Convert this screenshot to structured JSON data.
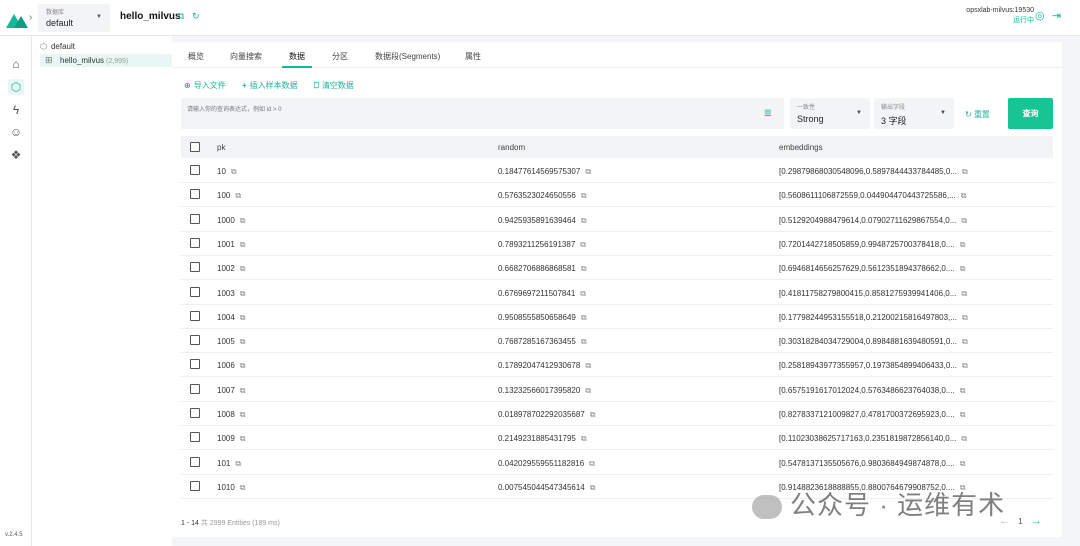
{
  "topbar": {
    "db_label": "数据库",
    "db_value": "default",
    "collection_title": "hello_milvus",
    "connection_host": "opsxlab-milvus:19530",
    "connection_status": "运行中"
  },
  "sidebar": {
    "icons": [
      "home-icon",
      "collection-icon",
      "lightning-icon",
      "user-icon",
      "settings-icon"
    ],
    "version": "v.2.4.5"
  },
  "tree": {
    "database": "default",
    "collection": "hello_milvus",
    "collection_count": "(2,999)"
  },
  "tabs": [
    "概览",
    "向量搜索",
    "数据",
    "分区",
    "数据段(Segments)",
    "属性"
  ],
  "actions": {
    "import_file": "导入文件",
    "insert_sample": "插入样本数据",
    "empty_data": "清空数据"
  },
  "filter": {
    "placeholder": "请输入你的查询表达式，例如 id > 0"
  },
  "consistency": {
    "label": "一致性",
    "value": "Strong"
  },
  "output_fields": {
    "label": "输出字段",
    "value": "3 字段"
  },
  "reset_label": "重置",
  "query_label": "查询",
  "table": {
    "columns": [
      "pk",
      "random",
      "embeddings"
    ],
    "rows": [
      {
        "pk": "10",
        "random": "0.18477614569575307",
        "emb": "[0.29879868030548096,0.5897844433784485,0..."
      },
      {
        "pk": "100",
        "random": "0.5763523024650556",
        "emb": "[0.5608611106872559,0.044904470443725586,..."
      },
      {
        "pk": "1000",
        "random": "0.9425935891639464",
        "emb": "[0.5129204988479614,0.07902711629867554,0..."
      },
      {
        "pk": "1001",
        "random": "0.7893211256191387",
        "emb": "[0.7201442718505859,0.9948725700378418,0...."
      },
      {
        "pk": "1002",
        "random": "0.6682706886868581",
        "emb": "[0.6946814656257629,0.5612351894378662,0...."
      },
      {
        "pk": "1003",
        "random": "0.6769697211507841",
        "emb": "[0.41811758279800415,0.8581275939941406,0..."
      },
      {
        "pk": "1004",
        "random": "0.9508555850658649",
        "emb": "[0.17798244953155518,0.21200215816497803,..."
      },
      {
        "pk": "1005",
        "random": "0.7687285167363455",
        "emb": "[0.30318284034729004,0.8984881639480591,0..."
      },
      {
        "pk": "1006",
        "random": "0.17892047412930678",
        "emb": "[0.25818943977355957,0.1973854899406433,0..."
      },
      {
        "pk": "1007",
        "random": "0.13232566017395820",
        "emb": "[0.6575191617012024,0.5763486623764038,0...."
      },
      {
        "pk": "1008",
        "random": "0.018978702292035687",
        "emb": "[0.8278337121009827,0.4781700372695923,0...."
      },
      {
        "pk": "1009",
        "random": "0.2149231885431795",
        "emb": "[0.11023038625717163,0.2351819872856140,0..."
      },
      {
        "pk": "101",
        "random": "0.042029559551182816",
        "emb": "[0.5478137135505676,0.9803684949874878,0...."
      },
      {
        "pk": "1010",
        "random": "0.007545044547345614",
        "emb": "[0.9148823618888855,0.8800764679908752,0...."
      }
    ]
  },
  "pagination": {
    "range": "1 - 14",
    "meta": "共 2999 Entities (189 ms)",
    "page": "1"
  },
  "watermark": "公众号 · 运维有术"
}
